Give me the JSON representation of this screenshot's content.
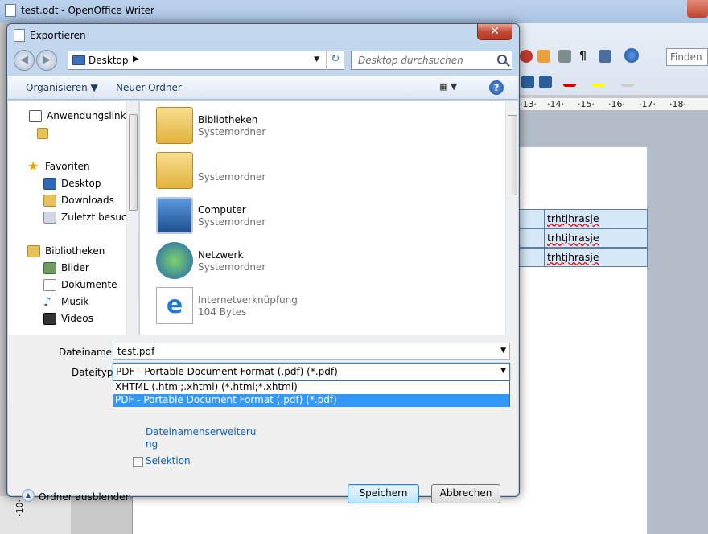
{
  "writer": {
    "title": "test.odt - OpenOffice Writer",
    "find_placeholder": "Finden",
    "ruler_ticks": [
      "·13·",
      "·14·",
      "·15·",
      "·16·",
      "·17·",
      "·18·"
    ],
    "left_ruler_tick": "·10·",
    "table_cells": [
      "trhtjhrasje",
      "trhtjhrasje",
      "trhtjhrasje"
    ]
  },
  "dialog": {
    "title": "Exportieren",
    "close_icon": "close-icon",
    "address": {
      "location": "Desktop",
      "arrow": "▶",
      "dropdown": "▼",
      "refresh": "↻"
    },
    "search": {
      "placeholder": "Desktop durchsuchen"
    },
    "nav_back": "◀",
    "nav_forward": "▶",
    "toolbar": {
      "organize_label": "Organisieren ▼",
      "new_folder_label": "Neuer Ordner",
      "views_label": "▦ ▼",
      "help_label": "?"
    },
    "nav_pane": {
      "items": [
        {
          "label": "Anwendungslinks",
          "icon": "shortcut-icon"
        },
        {
          "label": "",
          "icon": "folder-icon"
        },
        {
          "label": "Favoriten",
          "icon": "star-icon"
        },
        {
          "label": "Desktop",
          "icon": "desktop-icon"
        },
        {
          "label": "Downloads",
          "icon": "downloads-icon"
        },
        {
          "label": "Zuletzt besucht",
          "icon": "recent-icon"
        },
        {
          "label": "Bibliotheken",
          "icon": "library-icon"
        },
        {
          "label": "Bilder",
          "icon": "pictures-icon"
        },
        {
          "label": "Dokumente",
          "icon": "documents-icon"
        },
        {
          "label": "Musik",
          "icon": "music-icon"
        },
        {
          "label": "Videos",
          "icon": "videos-icon"
        }
      ]
    },
    "files": [
      {
        "name": "Bibliotheken",
        "sub": "Systemordner",
        "icon": "libraries-folder-icon"
      },
      {
        "name": "",
        "sub": "Systemordner",
        "icon": "user-folder-icon"
      },
      {
        "name": "Computer",
        "sub": "Systemordner",
        "icon": "computer-icon"
      },
      {
        "name": "Netzwerk",
        "sub": "Systemordner",
        "icon": "network-icon"
      },
      {
        "name": "Internetverknüpfung",
        "sub": "104 Bytes",
        "icon": "internet-shortcut-icon"
      }
    ],
    "filename": {
      "label": "Dateiname:",
      "value": "test.pdf"
    },
    "filetype": {
      "label": "Dateityp:",
      "selected": "PDF - Portable Document Format (.pdf) (*.pdf)",
      "options": [
        "XHTML (.html;.xhtml) (*.html;*.xhtml)",
        "PDF - Portable Document Format (.pdf) (*.pdf)"
      ]
    },
    "extension_link_line1": "Dateinamenserweiteru",
    "extension_link_line2": "ng",
    "selection_label": "Selektion",
    "hide_folders_label": "Ordner ausblenden",
    "save_label": "Speichern",
    "cancel_label": "Abbrechen"
  }
}
